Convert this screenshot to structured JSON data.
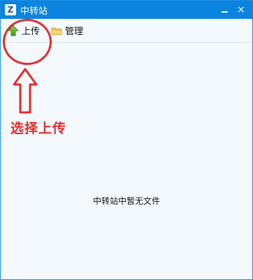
{
  "window": {
    "title": "中转站",
    "logo_letter": "Z",
    "minimize_icon": "minimize-icon",
    "close_label": "×"
  },
  "toolbar": {
    "upload_label": "上传",
    "upload_icon": "upload-arrow-icon",
    "manage_label": "管理",
    "manage_icon": "folder-icon"
  },
  "annotation": {
    "label": "选择上传",
    "color": "#e52a2a"
  },
  "content": {
    "empty_message": "中转站中暂无文件"
  },
  "colors": {
    "titlebar": "#0a84de",
    "background": "#f3f9fc",
    "accent_red": "#e52a2a"
  }
}
